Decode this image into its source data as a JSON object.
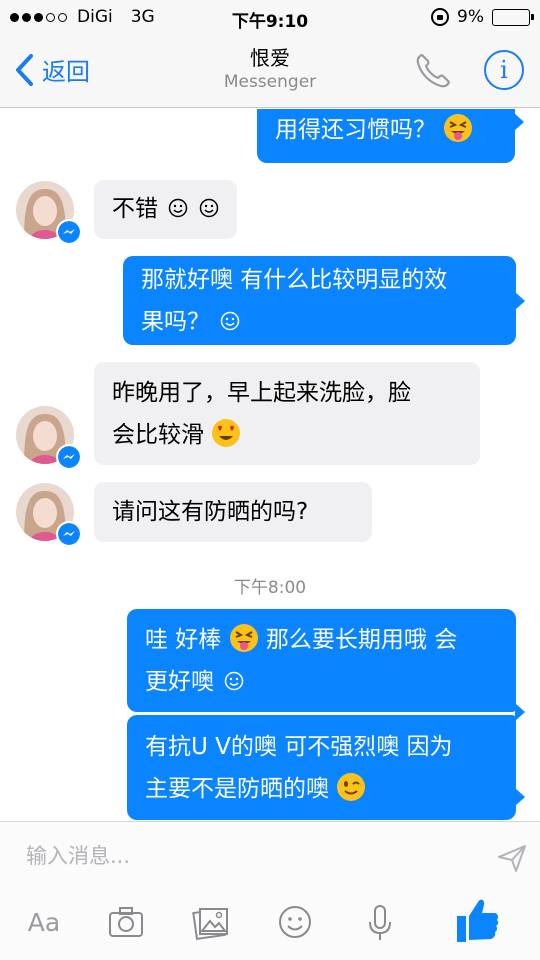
{
  "status_bar": {
    "carrier": "DiGi",
    "network": "3G",
    "time": "下午9:10",
    "battery": "9%",
    "battery_level": 0.09,
    "battery_color": "#e8222f"
  },
  "nav": {
    "back_label": "返回",
    "title": "恨爱",
    "subtitle": "Messenger"
  },
  "messages": [
    {
      "direction": "out",
      "text": "用得还习惯吗？",
      "emoji": "squinting-tongue-face"
    },
    {
      "direction": "in",
      "text": "不错",
      "emoji": "smiley-smiley"
    },
    {
      "direction": "out",
      "line1": "那就好噢 有什么比较明显的效",
      "line2": "果吗？",
      "emoji": "smiley"
    },
    {
      "direction": "in",
      "line1": "昨晚用了，早上起来洗脸，脸",
      "line2": "会比较滑",
      "emoji": "heart-eyes-face"
    },
    {
      "direction": "in",
      "text": "请问这有防晒的吗?"
    },
    {
      "direction": "out",
      "line1a": "哇 好棒",
      "line1b": " 那么要长期用哦 会",
      "line2": "更好噢",
      "emoji": "squinting-tongue-face, smiley"
    },
    {
      "direction": "out",
      "line1": "有抗U V的噢 可不强烈噢 因为",
      "line2": "主要不是防晒的噢",
      "emoji": "winking-face"
    }
  ],
  "timestamp": "下午8:00",
  "composer": {
    "placeholder": "输入消息...",
    "aa_label": "Aa"
  },
  "colors": {
    "accent": "#1a7cf2",
    "outgoing_bubble": "#0a84ff",
    "incoming_bubble": "#f0f0f2"
  }
}
